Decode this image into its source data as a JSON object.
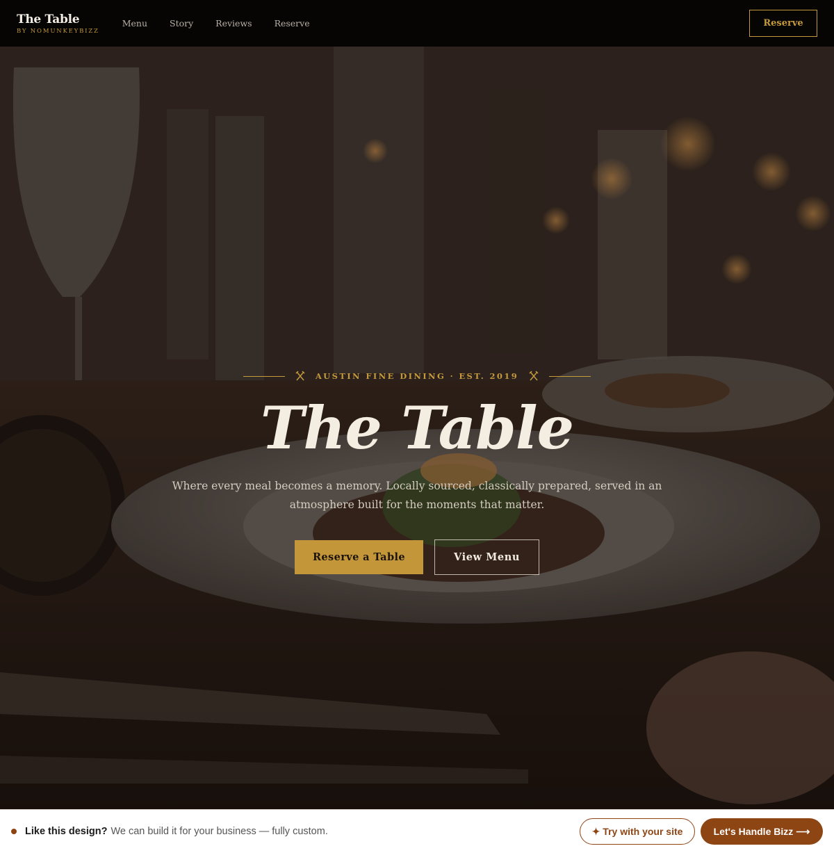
{
  "nav": {
    "brand_title": "The Table",
    "brand_sub": "BY NOMUNKEYBIZZ",
    "links": [
      "Menu",
      "Story",
      "Reviews",
      "Reserve"
    ],
    "cta": "Reserve"
  },
  "hero": {
    "eyebrow": "AUSTIN FINE DINING · EST. 2019",
    "eyebrow_icon": "fork-knife-icon",
    "title": "The Table",
    "description": "Where every meal becomes a memory. Locally sourced, classically prepared, served in an atmosphere built for the moments that matter.",
    "primary_button": "Reserve a Table",
    "secondary_button": "View Menu",
    "background": "restaurant-table-photo"
  },
  "promo": {
    "lead": "Like this design?",
    "rest": "We can build it for your business — fully custom.",
    "try_button": "Try with your site",
    "try_icon": "sparkle-icon",
    "cta_button": "Let's Handle Bizz",
    "cta_icon": "arrow-right-icon"
  },
  "colors": {
    "accent_gold": "#c4963a",
    "nav_bg": "#060504",
    "promo_brown": "#8e4514"
  }
}
